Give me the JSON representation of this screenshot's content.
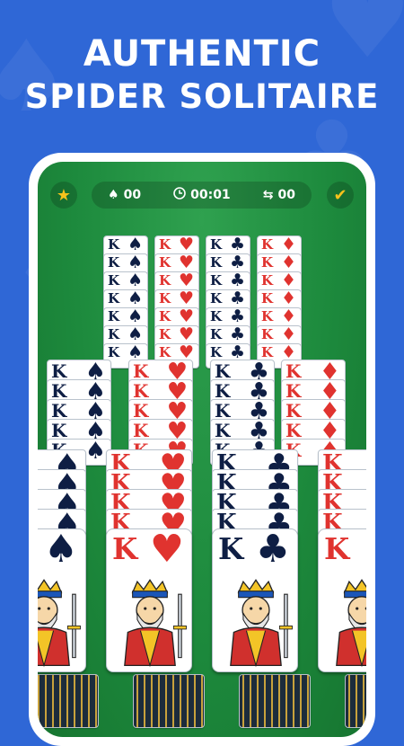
{
  "headline": {
    "line1": "AUTHENTIC",
    "line2": "SPIDER SOLITAIRE"
  },
  "game": {
    "favorite_icon": "star-icon",
    "moves_icon": "spade-icon",
    "moves": "00",
    "timer_icon": "clock-icon",
    "timer": "00:01",
    "swaps_icon": "arrows-swap-icon",
    "swaps": "00",
    "complete_icon": "checkmark-icon"
  },
  "card_rank": "K",
  "suits": {
    "spade": "♠",
    "heart": "♥",
    "club": "♣",
    "diamond": "♦"
  },
  "colors": {
    "background": "#2f67d6",
    "felt": "#1d8a3d",
    "red_suit": "#e0332f",
    "black_suit": "#0e1e44",
    "accent": "#f6c21c"
  }
}
